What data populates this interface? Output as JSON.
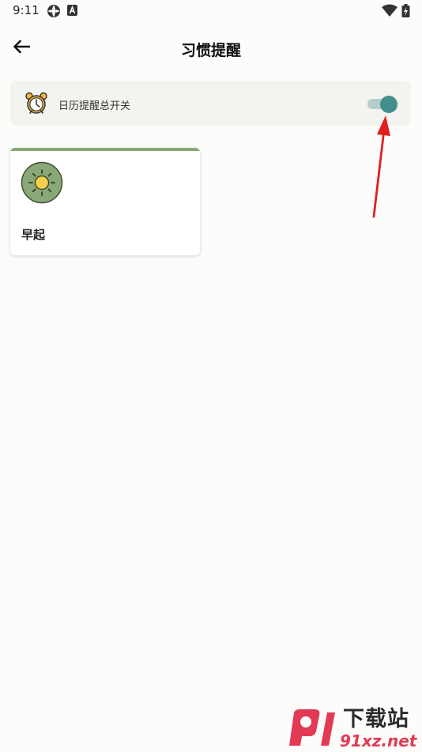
{
  "status_bar": {
    "time": "9:11",
    "icons": [
      "gear-icon",
      "a-box-icon",
      "wifi-icon",
      "battery-icon"
    ]
  },
  "header": {
    "title": "习惯提醒",
    "back_icon": "arrow-left-icon"
  },
  "master_switch": {
    "icon": "alarm-clock-icon",
    "label": "日历提醒总开关",
    "enabled": true,
    "accent_color": "#438f8c"
  },
  "habits": [
    {
      "name": "早起",
      "icon": "sun-icon",
      "strip_color": "#8aa877",
      "icon_bg_color": "#8aa877"
    }
  ],
  "annotation": {
    "arrow_color": "#e02020"
  },
  "watermark": {
    "title": "下载站",
    "domain": "91xz.net"
  }
}
